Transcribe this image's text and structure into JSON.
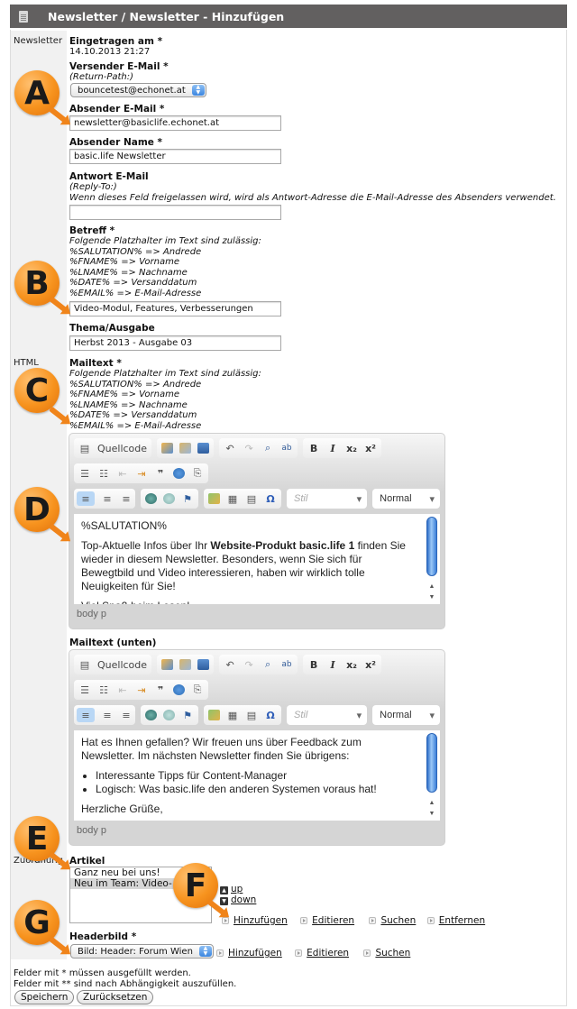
{
  "header": {
    "title": "Newsletter / Newsletter - Hinzufügen",
    "icon": "document-icon"
  },
  "sections": {
    "newsletter": "Newsletter",
    "html": "HTML",
    "zuordnung": "Zuordnung"
  },
  "fields": {
    "eingetragen": {
      "label": "Eingetragen am *",
      "value": "14.10.2013 21:27"
    },
    "versender": {
      "label": "Versender E-Mail *",
      "hint": "(Return-Path:)",
      "selected": "bouncetest@echonet.at"
    },
    "absender_email": {
      "label": "Absender E-Mail *",
      "value": "newsletter@basiclife.echonet.at"
    },
    "absender_name": {
      "label": "Absender Name *",
      "value": "basic.life Newsletter"
    },
    "antwort": {
      "label": "Antwort E-Mail",
      "hint": "(Reply-To:)",
      "hint2": "Wenn dieses Feld freigelassen wird, wird als Antwort-Adresse die E-Mail-Adresse des Absenders verwendet.",
      "value": ""
    },
    "betreff": {
      "label": "Betreff *",
      "hint": "Folgende Platzhalter im Text sind zulässig:",
      "placeholders": [
        "%SALUTATION% => Andrede",
        "%FNAME% => Vorname",
        "%LNAME% => Nachname",
        "%DATE% => Versanddatum",
        "%EMAIL% => E-Mail-Adresse"
      ],
      "value": "Video-Modul, Features, Verbesserungen"
    },
    "thema": {
      "label": "Thema/Ausgabe",
      "value": "Herbst 2013 - Ausgabe 03"
    },
    "mailtext": {
      "label": "Mailtext *",
      "hint": "Folgende Platzhalter im Text sind zulässig:",
      "placeholders": [
        "%SALUTATION% => Andrede",
        "%FNAME% => Vorname",
        "%LNAME% => Nachname",
        "%DATE% => Versanddatum",
        "%EMAIL% => E-Mail-Adresse"
      ]
    },
    "mailtext_unten": {
      "label": "Mailtext (unten)"
    },
    "artikel": {
      "label": "Artikel",
      "options": [
        "Ganz neu bei uns!",
        "Neu im Team: Video-"
      ],
      "selected_index": 1
    },
    "headerbild": {
      "label": "Headerbild *",
      "selected": "Bild: Header: Forum Wien"
    }
  },
  "toolbar": {
    "source": "Quellcode",
    "bold": "B",
    "italic": "I",
    "subscript": "x₂",
    "superscript": "x²",
    "style_placeholder": "Stil",
    "format": "Normal"
  },
  "editor1": {
    "p1": "%SALUTATION%",
    "p2_pre": "Top-Aktuelle Infos über Ihr ",
    "p2_bold": "Website-Produkt basic.life 1",
    "p2_post": " finden Sie wieder in diesem Newsletter. Besonders, wenn Sie sich für Bewegtbild und Video interessieren, haben wir wirklich tolle Neuigkeiten für Sie!",
    "p3": "Viel Spaß beim Lesen!",
    "path": "body  p"
  },
  "editor2": {
    "p1": "Hat es Ihnen gefallen? Wir freuen uns über Feedback zum Newsletter. Im nächsten Newsletter finden Sie übrigens:",
    "list": [
      "Interessante Tipps für Content-Manager",
      "Logisch: Was basic.life den anderen Systemen voraus hat!"
    ],
    "p2": "Herzliche Grüße,",
    "path": "body  p"
  },
  "artikel_actions": {
    "up": "up",
    "down": "down",
    "add": "Hinzufügen",
    "edit": "Editieren",
    "search": "Suchen",
    "remove": "Entfernen"
  },
  "headerbild_actions": {
    "add": "Hinzufügen",
    "edit": "Editieren",
    "search": "Suchen"
  },
  "footer": {
    "note1": "Felder mit * müssen ausgefüllt werden.",
    "note2": "Felder mit ** sind nach Abhängigkeit auszufüllen.",
    "save": "Speichern",
    "reset": "Zurücksetzen"
  },
  "callouts": [
    "A",
    "B",
    "C",
    "D",
    "E",
    "F",
    "G"
  ],
  "colors": {
    "titlebar": "#626060",
    "callout": "#f7931e",
    "accent_blue": "#3b86e0"
  }
}
